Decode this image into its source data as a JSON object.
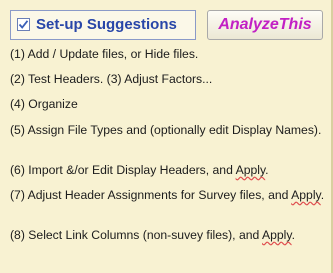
{
  "header": {
    "checkbox_checked": true,
    "suggestions_label": "Set-up Suggestions",
    "analyze_button_label": "AnalyzeThis"
  },
  "steps": [
    {
      "text": "(1) Add / Update files, or Hide files."
    },
    {
      "text": "(2) Test Headers.  (3) Adjust Factors..."
    },
    {
      "text": "(4) Organize"
    },
    {
      "text": "(5) Assign File Types and (optionally edit Display Names)."
    },
    {
      "before": "(6) Import &/or Edit Display Headers, and ",
      "apply": "Apply",
      "after": "."
    },
    {
      "before": "(7) Adjust Header Assignments for Survey files, and ",
      "apply": "Apply",
      "after": "."
    },
    {
      "before": "(8) Select Link Columns (non-suvey files), and ",
      "apply": "Apply",
      "after": "."
    }
  ],
  "colors": {
    "background": "#f8f2d2",
    "suggestions_text": "#2846a8",
    "analyze_text": "#c220c4",
    "spellcheck_underline": "#e05050"
  }
}
